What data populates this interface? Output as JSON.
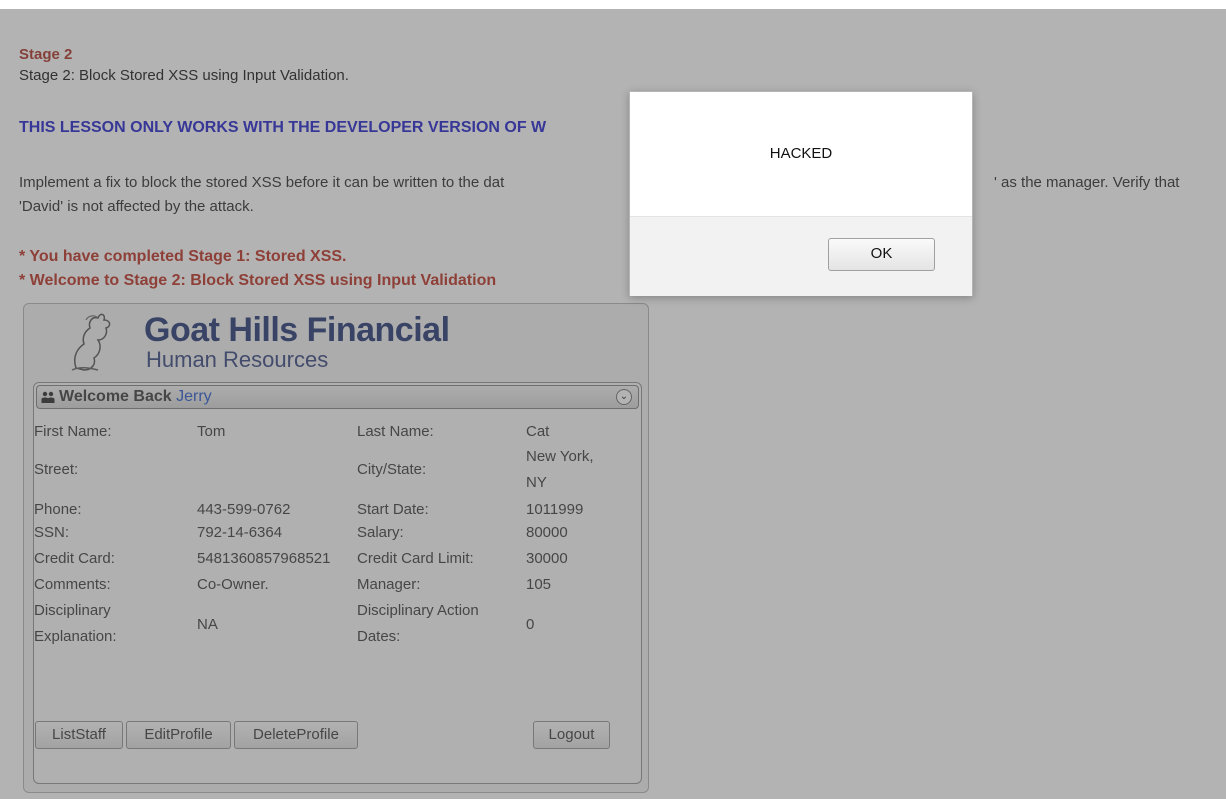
{
  "lesson": {
    "stage_title": "Stage 2",
    "stage_subtitle": "Stage 2: Block Stored XSS using Input Validation.",
    "note": "THIS LESSON ONLY WORKS WITH THE DEVELOPER VERSION OF W",
    "instructions_left": "Implement a fix to block the stored XSS before it can be written to the dat",
    "instructions_right": "' as the manager. Verify that",
    "instructions_line2": "'David' is not affected by the attack.",
    "msg_completed": "* You have completed Stage 1: Stored XSS.",
    "msg_welcome": "* Welcome to Stage 2: Block Stored XSS using Input Validation"
  },
  "app": {
    "brand_main": "Goat Hills Financial",
    "brand_sub": "Human Resources",
    "welcome_label": "Welcome Back",
    "username": "Jerry",
    "profile": {
      "first_name_label": "First Name:",
      "first_name": "Tom",
      "last_name_label": "Last Name:",
      "last_name": "Cat",
      "street_label": "Street:",
      "street": "",
      "city_label": "City/State:",
      "city_line1": "New York,",
      "city_line2": "NY",
      "phone_label": "Phone:",
      "phone": "443-599-0762",
      "start_date_label": "Start Date:",
      "start_date": "1011999",
      "ssn_label": "SSN:",
      "ssn": "792-14-6364",
      "salary_label": "Salary:",
      "salary": "80000",
      "cc_label": "Credit Card:",
      "cc": "5481360857968521",
      "cc_limit_label": "Credit Card Limit:",
      "cc_limit": "30000",
      "comments_label": "Comments:",
      "comments": "Co-Owner.",
      "manager_label": "Manager:",
      "manager": "105",
      "disc_expl_label_1": "Disciplinary",
      "disc_expl_label_2": "Explanation:",
      "disc_expl": "NA",
      "disc_dates_label_1": "Disciplinary Action",
      "disc_dates_label_2": "Dates:",
      "disc_dates": "0"
    },
    "buttons": {
      "list_staff": "ListStaff",
      "edit_profile": "EditProfile",
      "delete_profile": "DeleteProfile",
      "logout": "Logout"
    }
  },
  "dialog": {
    "message": "HACKED",
    "ok_label": "OK"
  }
}
